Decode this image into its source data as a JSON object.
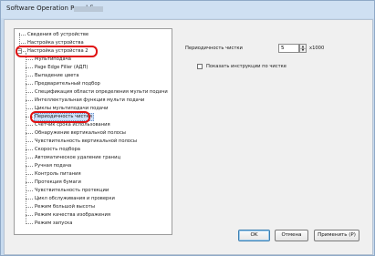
{
  "window": {
    "title": "Software Operation Panel fi-"
  },
  "tree": {
    "items": [
      {
        "label": "Сведения об устройстве",
        "level": 0
      },
      {
        "label": "Настройка устройства",
        "level": 0
      },
      {
        "label": "Настройка устройства 2",
        "level": 0,
        "expander": "−"
      },
      {
        "label": "Мультиподача",
        "level": 1
      },
      {
        "label": "Page Edge Filler (АДП)",
        "level": 1
      },
      {
        "label": "Выпадение цвета",
        "level": 1
      },
      {
        "label": "Предварительный подбор",
        "level": 1
      },
      {
        "label": "Спецификация области определения мульти подачи",
        "level": 1
      },
      {
        "label": "Интеллектуальная функция мульти подачи",
        "level": 1
      },
      {
        "label": "Циклы мультиподачи подачи",
        "level": 1
      },
      {
        "label": "Периодичность чистки",
        "level": 1,
        "selected": true
      },
      {
        "label": "Счетчик срока использования",
        "level": 1
      },
      {
        "label": "Обнаружение вертикальной полосы",
        "level": 1
      },
      {
        "label": "Чувствительность вертикальной полосы",
        "level": 1
      },
      {
        "label": "Скорость подбора",
        "level": 1
      },
      {
        "label": "Автоматическое удаление границ",
        "level": 1
      },
      {
        "label": "Ручная подача",
        "level": 1
      },
      {
        "label": "Контроль питания",
        "level": 1
      },
      {
        "label": "Протекция бумаги",
        "level": 1
      },
      {
        "label": "Чувствительность протекции",
        "level": 1
      },
      {
        "label": "Цикл обслуживания и проверки",
        "level": 1
      },
      {
        "label": "Режим большой высоты",
        "level": 1
      },
      {
        "label": "Режим качества изображения",
        "level": 1
      },
      {
        "label": "Режим запуска",
        "level": 1
      }
    ]
  },
  "settings": {
    "cleaning_cycle_label": "Периодичность чистки",
    "cleaning_cycle_value": "5",
    "cleaning_cycle_unit": "x1000",
    "spin_up": "▲",
    "spin_down": "▼",
    "show_instructions_label": "Показать инструкции по чистке",
    "show_instructions_checked": false
  },
  "buttons": {
    "ok": "OK",
    "cancel": "Отмена",
    "apply": "Применить (P)"
  },
  "colors": {
    "highlight": "#e01010",
    "selection": "#cfe3fb"
  }
}
